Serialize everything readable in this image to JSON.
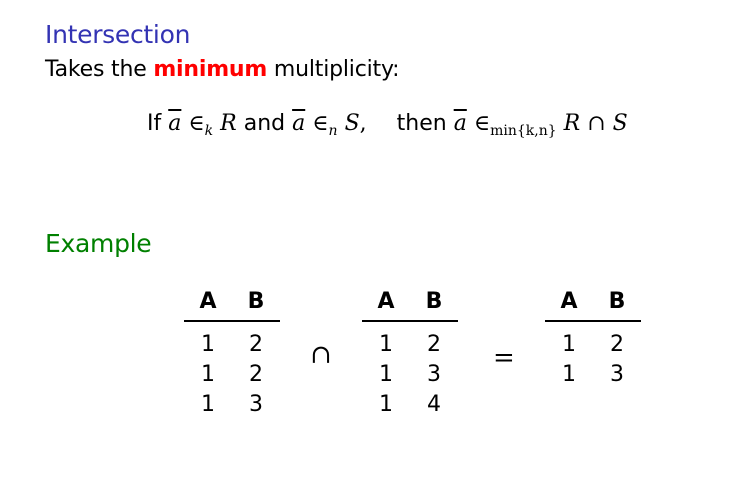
{
  "title": "Intersection",
  "subtitle": {
    "prefix": "Takes the ",
    "highlight": "minimum",
    "suffix": " multiplicity:"
  },
  "formula": {
    "if": "If ",
    "a": "a",
    "in": "∈",
    "k": "k",
    "R": "R",
    "and": " and ",
    "n": "n",
    "S": "S",
    "comma": ",",
    "then": "then ",
    "min": "min{k,n}",
    "cap": "∩"
  },
  "example_heading": "Example",
  "relations": [
    {
      "headers": [
        "A",
        "B"
      ],
      "rows": [
        [
          "1",
          "2"
        ],
        [
          "1",
          "2"
        ],
        [
          "1",
          "3"
        ]
      ]
    },
    {
      "headers": [
        "A",
        "B"
      ],
      "rows": [
        [
          "1",
          "2"
        ],
        [
          "1",
          "3"
        ],
        [
          "1",
          "4"
        ]
      ]
    },
    {
      "headers": [
        "A",
        "B"
      ],
      "rows": [
        [
          "1",
          "2"
        ],
        [
          "1",
          "3"
        ]
      ]
    }
  ],
  "operators": {
    "intersect": "∩",
    "equals": "="
  }
}
